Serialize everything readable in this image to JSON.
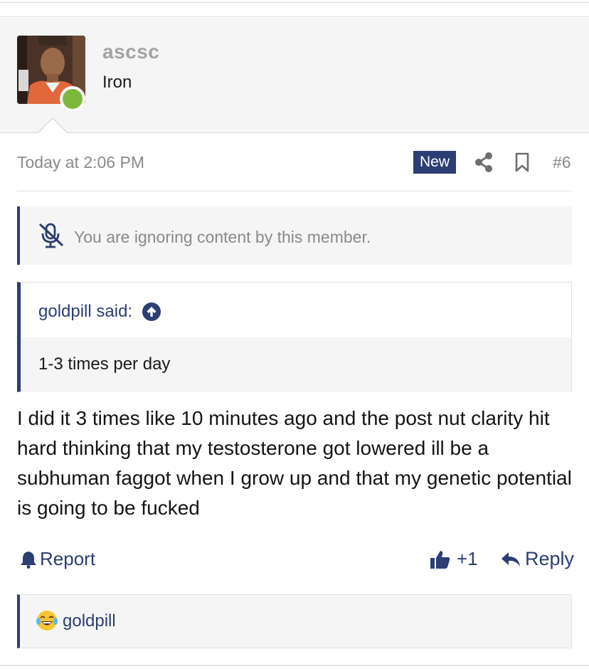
{
  "author": {
    "username": "ascsc",
    "title": "Iron",
    "online_color": "#7cb83b"
  },
  "meta": {
    "timestamp": "Today at 2:06 PM",
    "badge": "New",
    "post_number": "#6",
    "share_icon": "share-icon",
    "bookmark_icon": "bookmark-icon"
  },
  "ignore_notice": {
    "icon": "mute-icon",
    "text": "You are ignoring content by this member."
  },
  "quote": {
    "attribution": "goldpill said:",
    "text": "1-3 times per day"
  },
  "message": {
    "body": "I did it 3 times like 10 minutes ago and the post nut clarity hit hard thinking that my testosterone got lowered ill be a subhuman faggot when I grow up and that my genetic potential is going to be fucked"
  },
  "actions": {
    "report_label": "Report",
    "like_count": "+1",
    "reply_label": "Reply"
  },
  "reactions": {
    "emoji": "joy-emoji",
    "user": "goldpill"
  },
  "colors": {
    "accent": "#2c3e73",
    "muted_text": "#8a8a8a",
    "panel_bg": "#f5f5f5"
  }
}
